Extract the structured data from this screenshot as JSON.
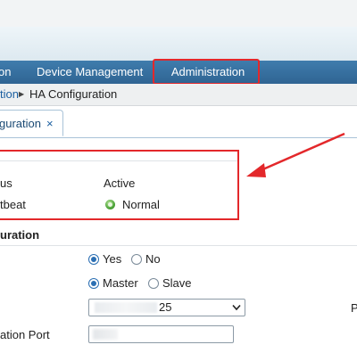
{
  "nav": {
    "items": [
      {
        "label": "on"
      },
      {
        "label": "Device Management"
      },
      {
        "label": "Administration"
      }
    ]
  },
  "breadcrumb": {
    "parent": "tion",
    "current": "HA Configuration"
  },
  "tab": {
    "label": "guration",
    "close": "×"
  },
  "status": {
    "label_status": "us",
    "value_status": "Active",
    "label_heartbeat": "tbeat",
    "value_heartbeat": "Normal"
  },
  "config": {
    "title": "uration",
    "enable": {
      "yes": "Yes",
      "no": "No",
      "selected": "Yes"
    },
    "mode": {
      "master": "Master",
      "slave": "Slave",
      "selected": "Master"
    },
    "select_value": "25",
    "right_edge_label": "P",
    "sync_port_label": "ation Port"
  },
  "colors": {
    "nav_bg": "#2f6493",
    "highlight": "#e3282b",
    "link": "#1b5fa0"
  }
}
